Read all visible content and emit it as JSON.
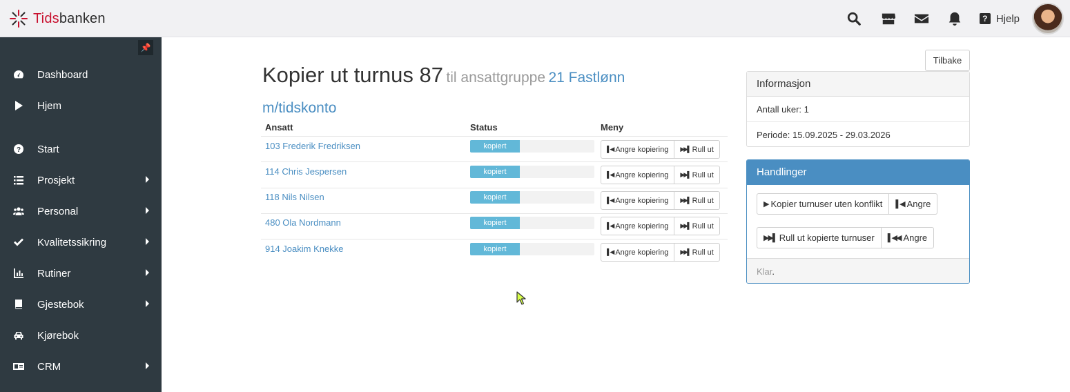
{
  "header": {
    "logo_red": "Tids",
    "logo_dark": "banken",
    "icons": [
      "search-icon",
      "store-icon",
      "mail-icon",
      "bell-icon",
      "help-icon"
    ],
    "help_label": "Hjelp",
    "help_glyph": "?"
  },
  "sidebar": {
    "pin_glyph": "📌",
    "items": [
      {
        "label": "Dashboard",
        "icon": "dashboard-icon",
        "submenu": false
      },
      {
        "label": "Hjem",
        "icon": "play-icon",
        "submenu": false
      },
      {
        "label": "Start",
        "icon": "question-circle-icon",
        "submenu": false
      },
      {
        "label": "Prosjekt",
        "icon": "list-icon",
        "submenu": true
      },
      {
        "label": "Personal",
        "icon": "users-icon",
        "submenu": true
      },
      {
        "label": "Kvalitetssikring",
        "icon": "check-icon",
        "submenu": true
      },
      {
        "label": "Rutiner",
        "icon": "chart-icon",
        "submenu": true
      },
      {
        "label": "Gjestebok",
        "icon": "book-icon",
        "submenu": true
      },
      {
        "label": "Kjørebok",
        "icon": "car-icon",
        "submenu": false
      },
      {
        "label": "CRM",
        "icon": "id-card-icon",
        "submenu": true
      }
    ]
  },
  "title": {
    "main": "Kopier ut turnus 87",
    "to_group": "til ansattgruppe",
    "group_link": "21 Fastlønn m/tidskonto"
  },
  "table": {
    "headers": {
      "employee": "Ansatt",
      "status": "Status",
      "menu": "Meny"
    },
    "undo_label": "Angre kopiering",
    "rollout_label": "Rull ut",
    "rows": [
      {
        "name": "103 Frederik Fredriksen",
        "status": "kopiert",
        "progress": 0.4
      },
      {
        "name": "114 Chris Jespersen",
        "status": "kopiert",
        "progress": 0.4
      },
      {
        "name": "118 Nils Nilsen",
        "status": "kopiert",
        "progress": 0.4
      },
      {
        "name": "480 Ola Nordmann",
        "status": "kopiert",
        "progress": 0.4
      },
      {
        "name": "914 Joakim Knekke",
        "status": "kopiert",
        "progress": 0.4
      }
    ]
  },
  "back_button": "Tilbake",
  "info_panel": {
    "title": "Informasjon",
    "weeks": "Antall uker: 1",
    "period": "Periode: 15.09.2025 - 29.03.2026"
  },
  "actions_panel": {
    "title": "Handlinger",
    "copy_without_conflict": "Kopier turnuser uten konflikt",
    "undo_1": "Angre",
    "rollout_copied": "Rull ut kopierte turnuser",
    "undo_2": "Angre",
    "status_word": "Klar",
    "status_dot": "."
  },
  "colors": {
    "accent": "#4a8ec2",
    "sidebar": "#2f3a41",
    "progress": "#62b8d8",
    "logo_red": "#c8102e"
  }
}
